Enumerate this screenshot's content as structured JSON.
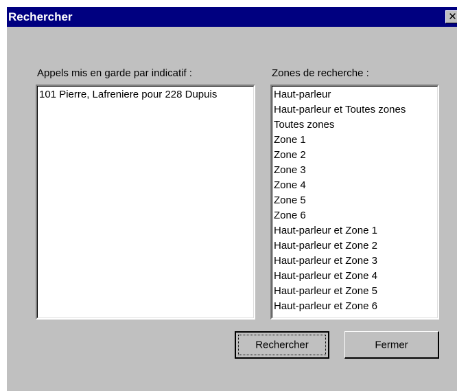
{
  "window": {
    "title": "Rechercher",
    "close_glyph": "✕"
  },
  "held_calls": {
    "label": "Appels mis en garde par indicatif :",
    "items": [
      "101 Pierre, Lafreniere  pour  228 Dupuis"
    ]
  },
  "zones": {
    "label": "Zones de recherche :",
    "items": [
      "Haut-parleur",
      "Haut-parleur et Toutes  zones",
      "Toutes  zones",
      "Zone 1",
      "Zone 2",
      "Zone 3",
      "Zone 4",
      "Zone 5",
      "Zone 6",
      "Haut-parleur et Zone 1",
      "Haut-parleur et Zone 2",
      "Haut-parleur et Zone 3",
      "Haut-parleur et Zone 4",
      "Haut-parleur et Zone 5",
      "Haut-parleur et Zone 6"
    ]
  },
  "buttons": {
    "search_label": "Rechercher",
    "close_label": "Fermer"
  },
  "colors": {
    "titlebar": "#000080",
    "dialog_face": "#c0c0c0",
    "list_background": "#ffffff"
  }
}
